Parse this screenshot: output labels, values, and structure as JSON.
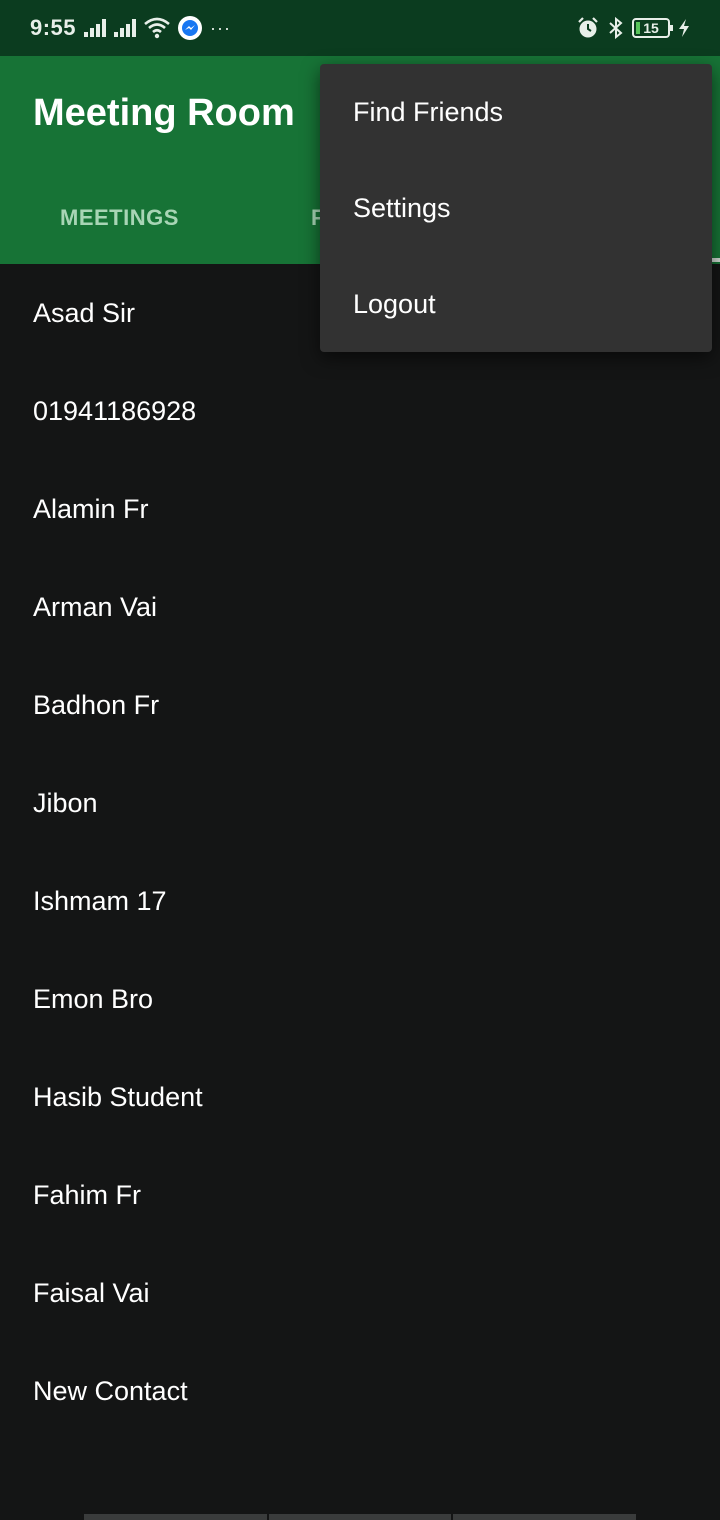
{
  "status_bar": {
    "time": "9:55",
    "more_indicator": "···",
    "battery_level": "15",
    "icons": [
      "signal-icon",
      "signal-icon",
      "wifi-icon",
      "messenger-icon",
      "alarm-icon",
      "bluetooth-icon",
      "battery-icon",
      "charging-icon"
    ]
  },
  "app_bar": {
    "title": "Meeting Room",
    "tabs": [
      {
        "label": "MEETINGS"
      },
      {
        "label": "F"
      }
    ],
    "colors": {
      "background": "#177336",
      "tab_text": "#a8d5b5"
    }
  },
  "overflow_menu": {
    "items": [
      {
        "label": "Find Friends"
      },
      {
        "label": "Settings"
      },
      {
        "label": "Logout"
      }
    ]
  },
  "contacts": [
    {
      "name": "Asad Sir"
    },
    {
      "name": "01941186928"
    },
    {
      "name": "Alamin Fr"
    },
    {
      "name": "Arman Vai"
    },
    {
      "name": "Badhon Fr"
    },
    {
      "name": "Jibon"
    },
    {
      "name": "Ishmam 17"
    },
    {
      "name": "Emon Bro"
    },
    {
      "name": "Hasib Student"
    },
    {
      "name": "Fahim Fr"
    },
    {
      "name": "Faisal Vai"
    },
    {
      "name": "New Contact"
    }
  ]
}
